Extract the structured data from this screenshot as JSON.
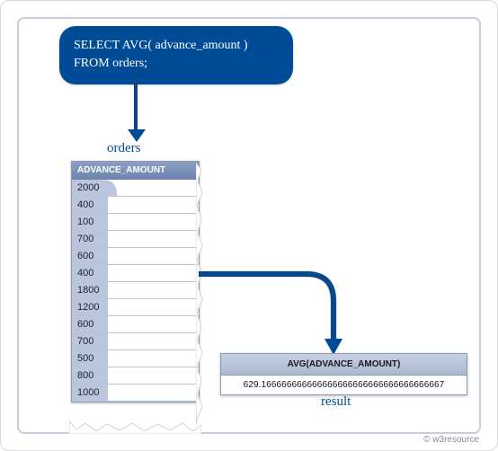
{
  "query": {
    "line1": "SELECT AVG( advance_amount )",
    "line2": "FROM orders;"
  },
  "orders": {
    "label": "orders",
    "header": "ADVANCE_AMOUNT",
    "rows": [
      "2000",
      "400",
      "100",
      "700",
      "600",
      "400",
      "1800",
      "1200",
      "600",
      "700",
      "500",
      "800",
      "1000"
    ]
  },
  "result": {
    "label": "result",
    "header": "AVG(ADVANCE_AMOUNT)",
    "value": "629.166666666666666666666666666666666667"
  },
  "credit": "© w3resource"
}
